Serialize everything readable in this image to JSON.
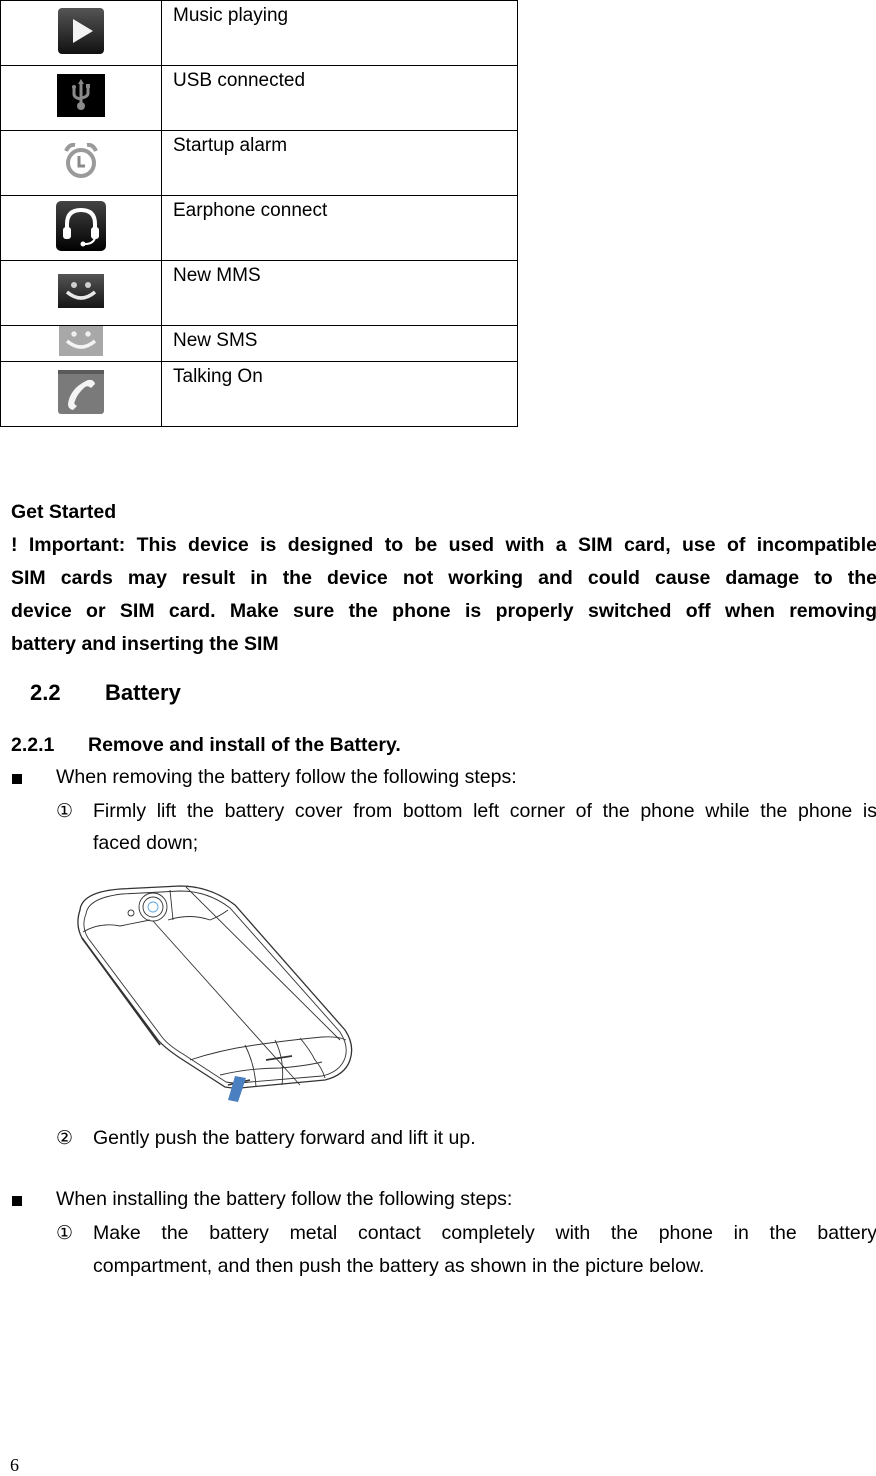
{
  "status_icons": [
    {
      "icon": "music-playing-icon",
      "label": "Music playing"
    },
    {
      "icon": "usb-connected-icon",
      "label": "USB connected"
    },
    {
      "icon": "startup-alarm-icon",
      "label": "Startup alarm"
    },
    {
      "icon": "earphone-icon",
      "label": "Earphone connect"
    },
    {
      "icon": "new-mms-icon",
      "label": "New MMS"
    },
    {
      "icon": "new-sms-icon",
      "label": "New SMS"
    },
    {
      "icon": "talking-on-icon",
      "label": "Talking On"
    }
  ],
  "get_started": {
    "title": "Get Started",
    "important_lines": [
      "! Important: This device is designed to be used with a SIM card, use of incompatible",
      "SIM cards may result in the device not working and could cause damage to the",
      "device or SIM card. Make sure the phone is properly switched off when removing",
      "battery and inserting the SIM"
    ]
  },
  "section": {
    "number": "2.2",
    "title": "Battery"
  },
  "subsection": {
    "number": "2.2.1",
    "title": "Remove and install of the Battery."
  },
  "removing": {
    "intro": "When removing the battery follow the following steps:",
    "steps": [
      {
        "marker": "①",
        "lines": [
          "Firmly lift the battery cover from bottom left corner of the phone while the phone is",
          "faced down;"
        ]
      },
      {
        "marker": "②",
        "lines": [
          "Gently push the battery forward and lift it up."
        ]
      }
    ],
    "figure": "phone-back-cover-illustration"
  },
  "installing": {
    "intro": "When installing the battery follow the following steps:",
    "steps": [
      {
        "marker": "①",
        "lines": [
          "Make the battery metal contact completely with the phone in the battery",
          "compartment, and then push the battery as shown in the picture below."
        ]
      }
    ]
  },
  "page_number": "6",
  "colors": {
    "arrow": "#4a7fc1",
    "camera_ring": "#5aa6e0"
  }
}
